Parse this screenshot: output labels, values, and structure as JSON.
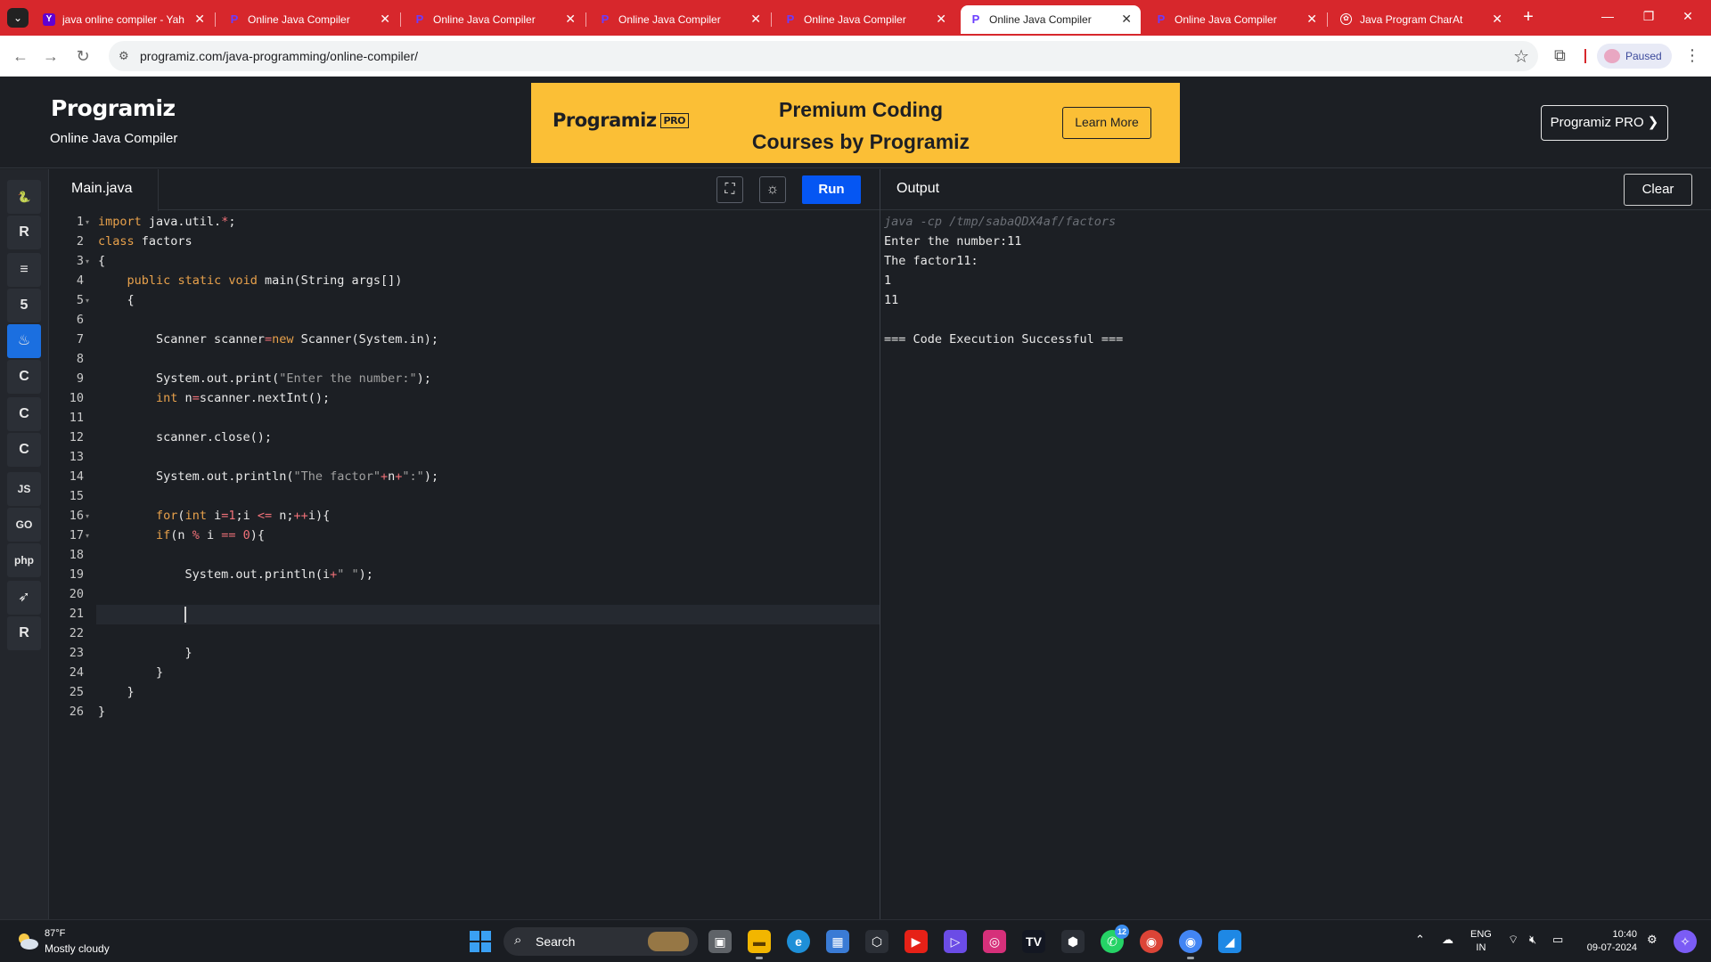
{
  "browser": {
    "tabs": [
      {
        "title": "java online compiler - Yah",
        "favicon": "yahoo-icon",
        "active": false
      },
      {
        "title": "Online Java Compiler",
        "favicon": "programiz-icon",
        "active": false
      },
      {
        "title": "Online Java Compiler",
        "favicon": "programiz-icon",
        "active": false
      },
      {
        "title": "Online Java Compiler",
        "favicon": "programiz-icon",
        "active": false
      },
      {
        "title": "Online Java Compiler",
        "favicon": "programiz-icon",
        "active": false
      },
      {
        "title": "Online Java Compiler",
        "favicon": "programiz-icon",
        "active": true
      },
      {
        "title": "Online Java Compiler",
        "favicon": "programiz-icon",
        "active": false
      },
      {
        "title": "Java Program CharAt",
        "favicon": "chatgpt-icon",
        "active": false
      }
    ],
    "url": "programiz.com/java-programming/online-compiler/",
    "profile_status": "Paused",
    "accent_color": "#d7272c"
  },
  "site": {
    "logo_text": "Programiz",
    "page_subtitle": "Online Java Compiler",
    "banner": {
      "logo_text": "Programiz",
      "logo_badge": "PRO",
      "headline_line1": "Premium Coding",
      "headline_line2": "Courses by Programiz",
      "cta": "Learn More"
    },
    "pro_button": "Programiz PRO ❯"
  },
  "rail": {
    "items": [
      {
        "name": "python",
        "glyph": "🐍"
      },
      {
        "name": "r",
        "glyph": "R"
      },
      {
        "name": "sql",
        "glyph": "≡"
      },
      {
        "name": "html",
        "glyph": "5"
      },
      {
        "name": "java",
        "glyph": "♨"
      },
      {
        "name": "c",
        "glyph": "C"
      },
      {
        "name": "cpp",
        "glyph": "C"
      },
      {
        "name": "csharp",
        "glyph": "C"
      },
      {
        "name": "javascript",
        "glyph": "JS"
      },
      {
        "name": "go",
        "glyph": "GO"
      },
      {
        "name": "php",
        "glyph": "php"
      },
      {
        "name": "swift",
        "glyph": "➶"
      },
      {
        "name": "rust",
        "glyph": "R"
      }
    ],
    "active_index": 4
  },
  "editor": {
    "file_name": "Main.java",
    "run_label": "Run",
    "lines": [
      "import java.util.*;",
      "class factors",
      "{",
      "    public static void main(String args[])",
      "    {",
      "",
      "        Scanner scanner=new Scanner(System.in);",
      "",
      "        System.out.print(\"Enter the number:\");",
      "        int n=scanner.nextInt();",
      "",
      "        scanner.close();",
      "",
      "        System.out.println(\"The factor\"+n+\":\");",
      "",
      "        for(int i=1;i <= n;++i){",
      "        if(n % i == 0){",
      "",
      "            System.out.println(i+\" \");",
      "",
      "",
      "",
      "            }",
      "        }",
      "    }",
      "}"
    ],
    "fold_lines": [
      1,
      3,
      5,
      16,
      17
    ],
    "active_line": 21
  },
  "output": {
    "title": "Output",
    "clear_label": "Clear",
    "lines": [
      "java -cp /tmp/sabaQDX4af/factors",
      "Enter the number:11",
      "The factor11:",
      "1",
      "11",
      "",
      "=== Code Execution Successful ==="
    ]
  },
  "taskbar": {
    "temperature": "87°F",
    "weather": "Mostly cloudy",
    "search_label": "Search",
    "whatsapp_badge": "12",
    "language_line1": "ENG",
    "language_line2": "IN",
    "time": "10:40",
    "date": "09-07-2024"
  }
}
